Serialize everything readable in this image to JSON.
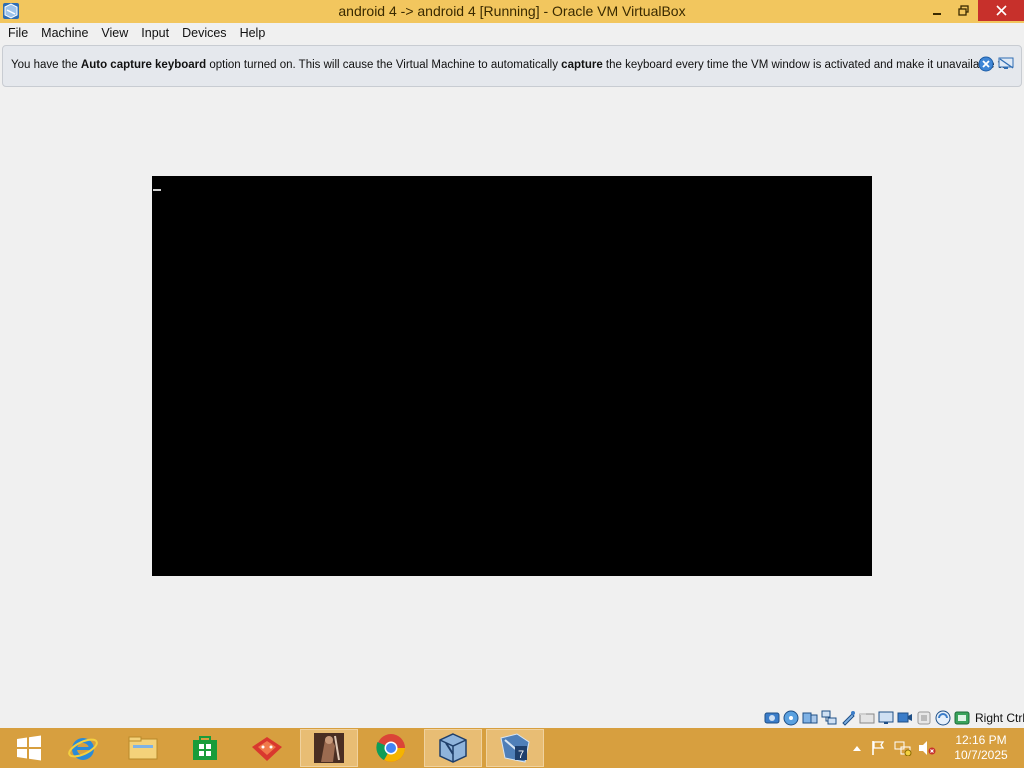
{
  "window": {
    "title": "android 4 -> android 4 [Running] - Oracle VM VirtualBox",
    "icon": "virtualbox-icon",
    "controls": {
      "minimize": "minimize-icon",
      "maximize": "restore-icon",
      "close": "close-icon"
    }
  },
  "menu": {
    "items": [
      "File",
      "Machine",
      "View",
      "Input",
      "Devices",
      "Help"
    ]
  },
  "notification": {
    "part1": "You have the ",
    "bold1": "Auto capture keyboard",
    "part2": " option turned on. This will cause the Virtual Machine to automatically ",
    "bold2": "capture",
    "part3": " the keyboard every time the VM window is activated and make it unavailable to"
  },
  "statusbar": {
    "icons": [
      "hard-disk-icon",
      "optical-drive-icon",
      "audio-icon",
      "network-icon",
      "usb-icon",
      "shared-folders-icon",
      "display-icon",
      "video-capture-icon",
      "virtualization-icon",
      "mouse-integration-icon",
      "keyboard-capture-icon"
    ],
    "host_key": "Right Ctrl"
  },
  "taskbar": {
    "buttons": [
      "start-button",
      "internet-explorer",
      "file-explorer",
      "windows-store",
      "gitkraken",
      "media-app",
      "chrome",
      "virtualbox",
      "app-7"
    ],
    "active": [
      "media-app",
      "virtualbox",
      "app-7"
    ],
    "tray_icons": [
      "show-hidden-icons",
      "action-center-flag-icon",
      "network-icon",
      "volume-muted-icon"
    ],
    "time": "12:16 PM",
    "date": "10/7/2025"
  },
  "colors": {
    "titlebar": "#f2c65e",
    "taskbar": "#d79f3f",
    "close_button": "#c7302b",
    "vm_screen": "#000000"
  }
}
